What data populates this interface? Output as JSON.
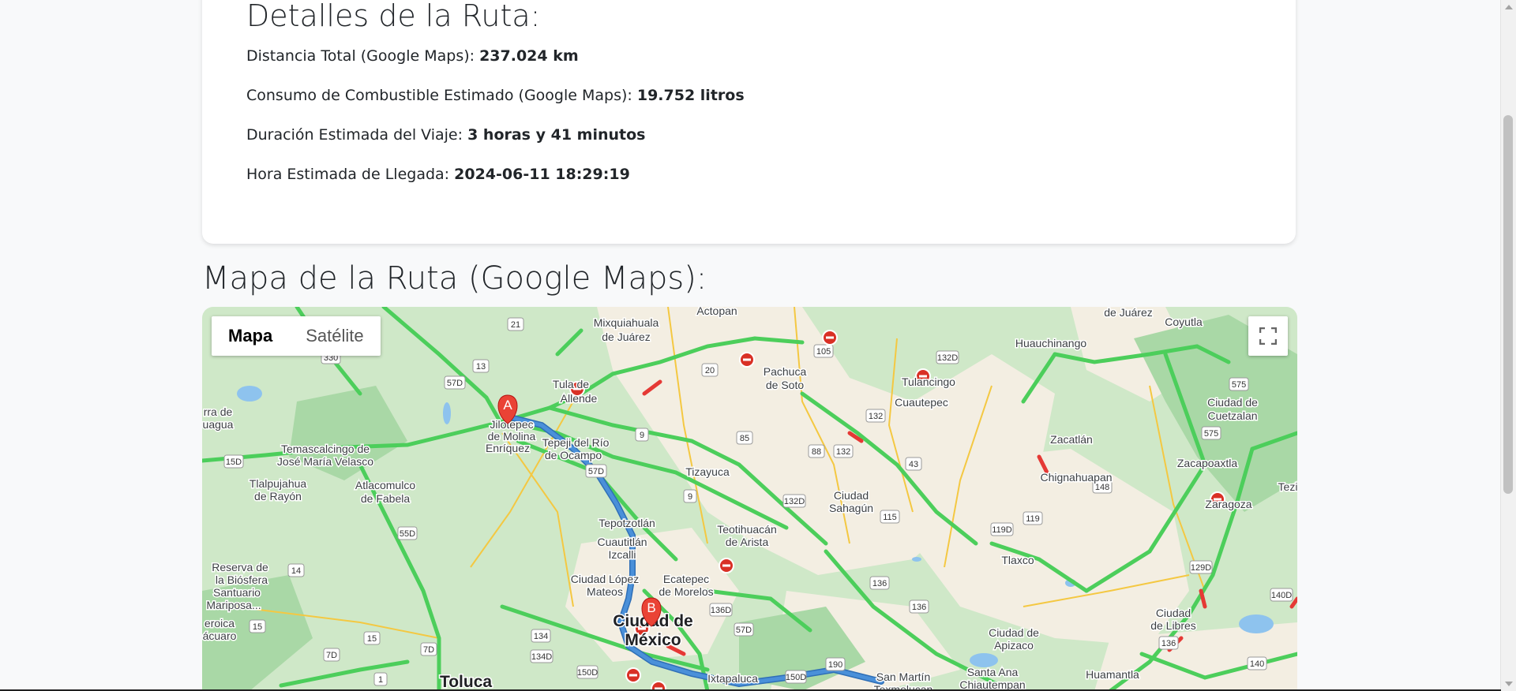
{
  "details": {
    "title": "Detalles de la Ruta:",
    "rows": [
      {
        "label": "Distancia Total (Google Maps): ",
        "value": "237.024 km"
      },
      {
        "label": "Consumo de Combustible Estimado (Google Maps): ",
        "value": "19.752 litros"
      },
      {
        "label": "Duración Estimada del Viaje: ",
        "value": "3 horas y 41 minutos"
      },
      {
        "label": "Hora Estimada de Llegada: ",
        "value": "2024-06-11 18:29:19"
      }
    ]
  },
  "map": {
    "title": "Mapa de la Ruta (Google Maps):",
    "type_buttons": {
      "map": "Mapa",
      "satellite": "Satélite",
      "selected": "Mapa"
    },
    "markers": {
      "origin": "A",
      "destination": "B"
    },
    "colors": {
      "land": "#cfe8c8",
      "urban": "#f3eee2",
      "traffic_green": "#4cce5b",
      "traffic_red": "#e53935",
      "route": "#4a90d9",
      "marker": "#ea4335"
    },
    "places": [
      "Mixquiahuala",
      "de Juárez",
      "Actopan",
      "Pachuca",
      "de Soto",
      "Tulancingo",
      "Cuautepec",
      "Huauchinango",
      "Coyutla",
      "Ciudad de",
      "Cuetzalan",
      "Zacatlán",
      "Chignahuapan",
      "Zacapoaxtla",
      "Zaragoza",
      "Tezi",
      "Tula de",
      "Allende",
      "Jilotepec",
      "de Molina",
      "Enríquez",
      "Tepeji del Río",
      "de Ocampo",
      "Temascalcingo de",
      "José María Velasco",
      "Tlalpujahua",
      "de Rayón",
      "Atlacomulco",
      "de Fabela",
      "Tizayuca",
      "Ciudad",
      "Sahagún",
      "Tepotzotlán",
      "Teotihuacán",
      "de Arista",
      "Cuautitlán",
      "Izcalli",
      "Ciudad López",
      "Mateos",
      "Ecatepec",
      "de Morelos",
      "Ciudad de",
      "México",
      "Tlaxco",
      "Ciudad de",
      "Apizaco",
      "Ciudad",
      "de Libres",
      "Huamantla",
      "Santa Ana",
      "Chiautempan",
      "San Martín",
      "Texmelucan",
      "Ixtapaluca",
      "Toluca",
      "Reserva de",
      "la Biósfera",
      "Santuario",
      "Mariposa...",
      "eroica",
      "ácuaro",
      "rra de",
      "uagua",
      "de Juárez",
      "Zaragoza"
    ],
    "road_shields": [
      "21",
      "13",
      "57D",
      "20",
      "105",
      "132D",
      "85",
      "88",
      "132",
      "9",
      "57D",
      "132D",
      "115",
      "43",
      "148",
      "119D",
      "119",
      "575",
      "575",
      "129D",
      "140D",
      "140",
      "15D",
      "55D",
      "14",
      "15",
      "15",
      "7D",
      "7D",
      "1",
      "134",
      "134D",
      "150D",
      "136D",
      "57D",
      "190",
      "150D",
      "136",
      "136",
      "136",
      "330",
      "9"
    ]
  }
}
